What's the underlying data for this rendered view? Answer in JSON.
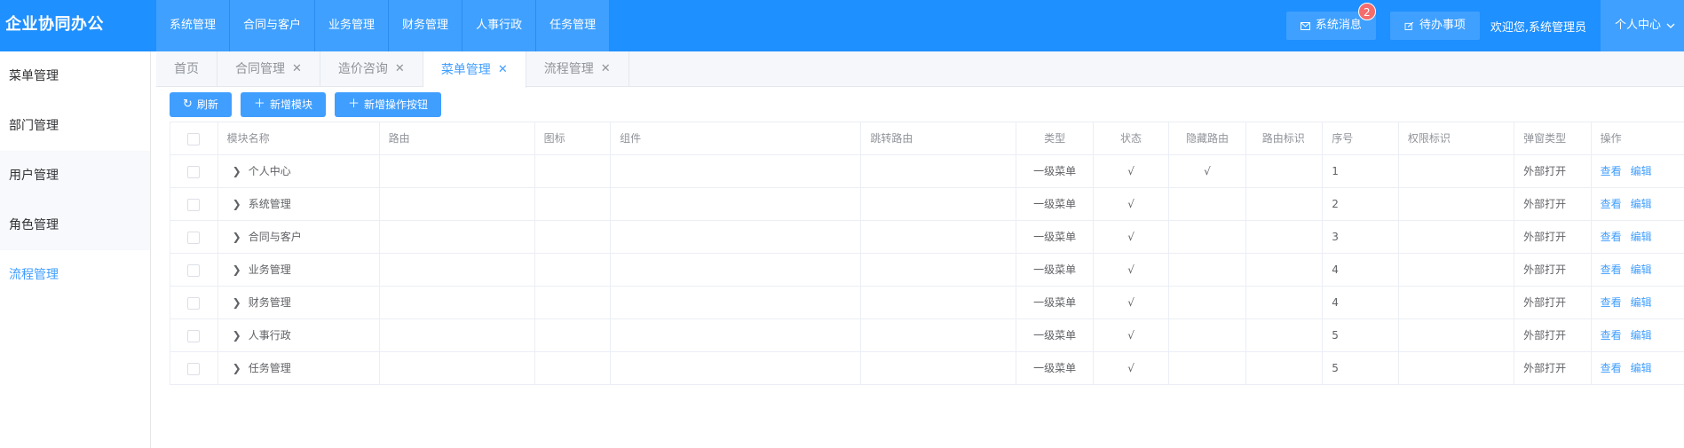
{
  "brand": "企业协同办公",
  "topnav": [
    "系统管理",
    "合同与客户",
    "业务管理",
    "财务管理",
    "人事行政",
    "任务管理"
  ],
  "header": {
    "messages_label": "系统消息",
    "messages_badge": "2",
    "todo_label": "待办事项",
    "welcome": "欢迎您,系统管理员",
    "user_menu": "个人中心"
  },
  "sidebar": {
    "items": [
      "菜单管理",
      "部门管理",
      "用户管理",
      "角色管理",
      "流程管理"
    ],
    "active_index": 4
  },
  "tabs": [
    {
      "label": "首页",
      "closable": false
    },
    {
      "label": "合同管理",
      "closable": true
    },
    {
      "label": "造价咨询",
      "closable": true
    },
    {
      "label": "菜单管理",
      "closable": true,
      "active": true
    },
    {
      "label": "流程管理",
      "closable": true
    }
  ],
  "toolbar": {
    "refresh": "刷新",
    "add_module": "新增模块",
    "add_op_button": "新增操作按钮"
  },
  "table": {
    "headers": {
      "name": "模块名称",
      "route": "路由",
      "icon": "图标",
      "component": "组件",
      "jump": "跳转路由",
      "type": "类型",
      "status": "状态",
      "hidden": "隐藏路由",
      "route_id": "路由标识",
      "seq": "序号",
      "perm": "权限标识",
      "popup": "弹窗类型",
      "ops": "操作"
    },
    "rows": [
      {
        "name": "个人中心",
        "type": "一级菜单",
        "status": "√",
        "hidden": "√",
        "seq": "1",
        "popup": "外部打开",
        "view": "查看",
        "edit": "编辑"
      },
      {
        "name": "系统管理",
        "type": "一级菜单",
        "status": "√",
        "hidden": "",
        "seq": "2",
        "popup": "外部打开",
        "view": "查看",
        "edit": "编辑"
      },
      {
        "name": "合同与客户",
        "type": "一级菜单",
        "status": "√",
        "hidden": "",
        "seq": "3",
        "popup": "外部打开",
        "view": "查看",
        "edit": "编辑"
      },
      {
        "name": "业务管理",
        "type": "一级菜单",
        "status": "√",
        "hidden": "",
        "seq": "4",
        "popup": "外部打开",
        "view": "查看",
        "edit": "编辑"
      },
      {
        "name": "财务管理",
        "type": "一级菜单",
        "status": "√",
        "hidden": "",
        "seq": "4",
        "popup": "外部打开",
        "view": "查看",
        "edit": "编辑"
      },
      {
        "name": "人事行政",
        "type": "一级菜单",
        "status": "√",
        "hidden": "",
        "seq": "5",
        "popup": "外部打开",
        "view": "查看",
        "edit": "编辑"
      },
      {
        "name": "任务管理",
        "type": "一级菜单",
        "status": "√",
        "hidden": "",
        "seq": "5",
        "popup": "外部打开",
        "view": "查看",
        "edit": "编辑"
      }
    ]
  },
  "colors": {
    "header_bg": "#1e90ff",
    "nav_item_bg": "#3fa0ff",
    "primary": "#409eff",
    "badge": "#f56c6c"
  }
}
